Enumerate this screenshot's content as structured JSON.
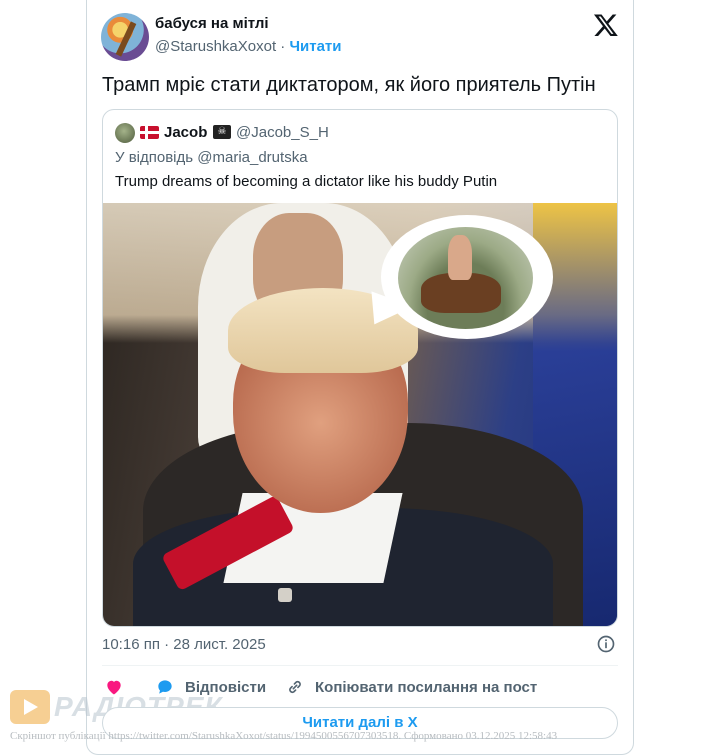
{
  "tweet": {
    "author_name": "бабуся на мітлі",
    "author_handle": "@StarushkaXoxot",
    "separator": "·",
    "follow_label": "Читати",
    "text": "Трамп мріє стати диктатором, як його приятель Путін",
    "time": "10:16 пп · 28 лист. 2025",
    "read_more_label": "Читати далі в X"
  },
  "quote": {
    "author_name": "Jacob",
    "author_handle": "@Jacob_S_H",
    "reply_prefix": "У відповідь",
    "reply_mention": "@maria_drutska",
    "text": "Trump dreams of becoming a dictator like his buddy Putin"
  },
  "actions": {
    "reply_label": "Відповісти",
    "copy_link_label": "Копіювати посилання на пост"
  },
  "watermark": {
    "logo_text": "РАДІОТРЕК",
    "caption": "Скріншот публікації https://twitter.com/StarushkaXoxot/status/1994500556707303518. Сформовано 03.12.2025 12:58:43"
  },
  "colors": {
    "accent": "#1d9bf0",
    "secondary_text": "#536471",
    "like": "#f91880"
  },
  "icons": [
    "x-logo-icon",
    "info-icon",
    "heart-icon",
    "reply-bubble-icon",
    "link-icon",
    "denmark-flag-icon",
    "pirate-flag-icon"
  ]
}
